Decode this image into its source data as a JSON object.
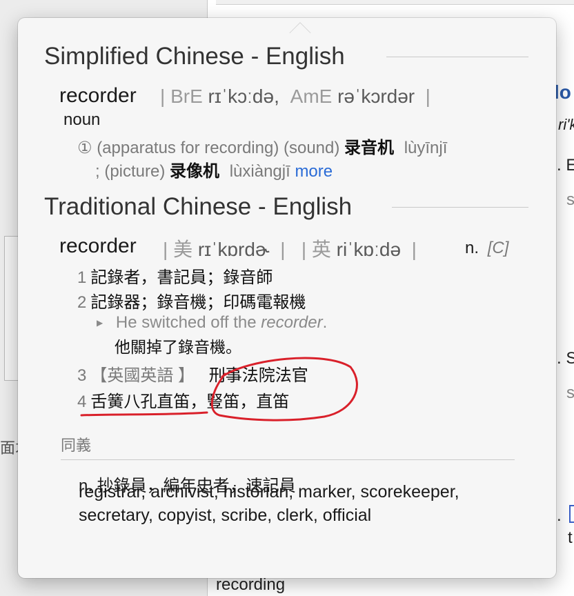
{
  "background": {
    "left_fragment": "面才",
    "doc_fragments": [
      "lo",
      "ri'k",
      ". E",
      "s",
      ". S",
      "s",
      ". ",
      "t"
    ],
    "bottom_word": "recording"
  },
  "simplified": {
    "title": "Simplified Chinese - English",
    "headword": "recorder",
    "pron_bre_label": "BrE",
    "pron_bre": "rɪˈkɔːdə,",
    "pron_ame_label": "AmE",
    "pron_ame": "rəˈkɔrdər",
    "pos": "noun",
    "sense_marker": "①",
    "sense_line1_gloss": "(apparatus for recording) (sound)",
    "sense_line1_cjk": "录音机",
    "sense_line1_pinyin": "lùyīnjī",
    "sense_line2_prefix": "; (picture)",
    "sense_line2_cjk": "录像机",
    "sense_line2_pinyin": "lùxiàngjī",
    "more_link": "more"
  },
  "traditional": {
    "title": "Traditional Chinese - English",
    "headword": "recorder",
    "pron_us_label": "美",
    "pron_us": "rɪˈkɒrdɚ",
    "pron_uk_label": "英",
    "pron_uk": "riˈkɒːdə",
    "pos": "n.",
    "grammar": "[C]",
    "senses": [
      {
        "num": "1",
        "text": "記錄者，書記員；錄音師"
      },
      {
        "num": "2",
        "text": "記錄器；錄音機；印碼電報機"
      },
      {
        "num": "3",
        "label": "【英國英語 】",
        "text": "刑事法院法官"
      },
      {
        "num": "4",
        "text": "舌簧八孔直笛，豎笛，直笛"
      }
    ],
    "example_pre": "He switched off the",
    "example_word": "recorder",
    "example_post": ".",
    "example_translation": "他關掉了錄音機。"
  },
  "synonyms": {
    "heading": "同義",
    "line1": "n. 抄錄員，編年史者，速記員",
    "list": "registrar, archivist, historian, marker, scorekeeper, secretary, copyist, scribe, clerk, official"
  },
  "colors": {
    "annotation": "#d9202a",
    "link": "#2a6bd6"
  }
}
